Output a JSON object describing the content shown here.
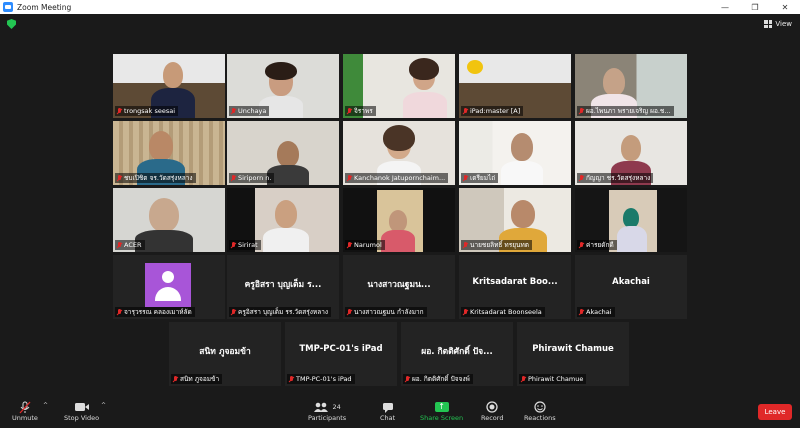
{
  "window": {
    "title": "Zoom Meeting",
    "minimize": "—",
    "restore": "❐",
    "close": "✕"
  },
  "top": {
    "view_label": "View"
  },
  "participants": [
    "trongsak seesai",
    "Unchaya",
    "จิราพร",
    "iPad:master [A]",
    "ผอ.ไพนภา  พรายเจริญ ผอ.ช...",
    "ชบเปิชิต  จร.วัดสรุ่งหลาง",
    "Siriporn n.",
    "Kanchanok Jatupornchaim...",
    "เตรียมไถ่",
    "กัญญา  ชร.วัดสรุ่งหลาง",
    "ACER",
    "Sirirat",
    "Narumol",
    "นายชยลิทธิ์   ทรยุนทต",
    "ค่ารยดักดี",
    "จารุวรรณ  คลองเมาห์ลัด",
    "ครูอิสรา  บุญเต็ม  รร.วัดสรุ่งหลาง",
    "นางสาวณฐมน     กำลังมาก",
    "Kritsadarat Boonseela",
    "Akachai",
    "สนิท ภูจอมข้า",
    "TMP-PC-01's iPad",
    "ผอ. กิตติศักดิ์  ปัจจงพ์",
    "Phirawit Chamue"
  ],
  "name_tiles": {
    "t17": "ครูอิสรา  บุญเต็ม  ร...",
    "t18": "นางสาวณฐมน...",
    "t19": "Kritsadarat  Boo...",
    "t20": "Akachai",
    "t21": "สนิท  ภูจอมข้า",
    "t22": "TMP-PC-01's iPad",
    "t23": "ผอ.  กิตติศักดิ์  ปัจ...",
    "t24": "Phirawit Chamue"
  },
  "toolbar": {
    "unmute": "Unmute",
    "stop_video": "Stop Video",
    "participants": "Participants",
    "participants_count": "24",
    "chat": "Chat",
    "share_screen": "Share Screen",
    "record": "Record",
    "reactions": "Reactions",
    "leave": "Leave"
  },
  "colors": {
    "accent_green": "#23c552",
    "leave_red": "#e02828",
    "active_speaker": "#8fd14f",
    "avatar_purple": "#a855d8"
  }
}
